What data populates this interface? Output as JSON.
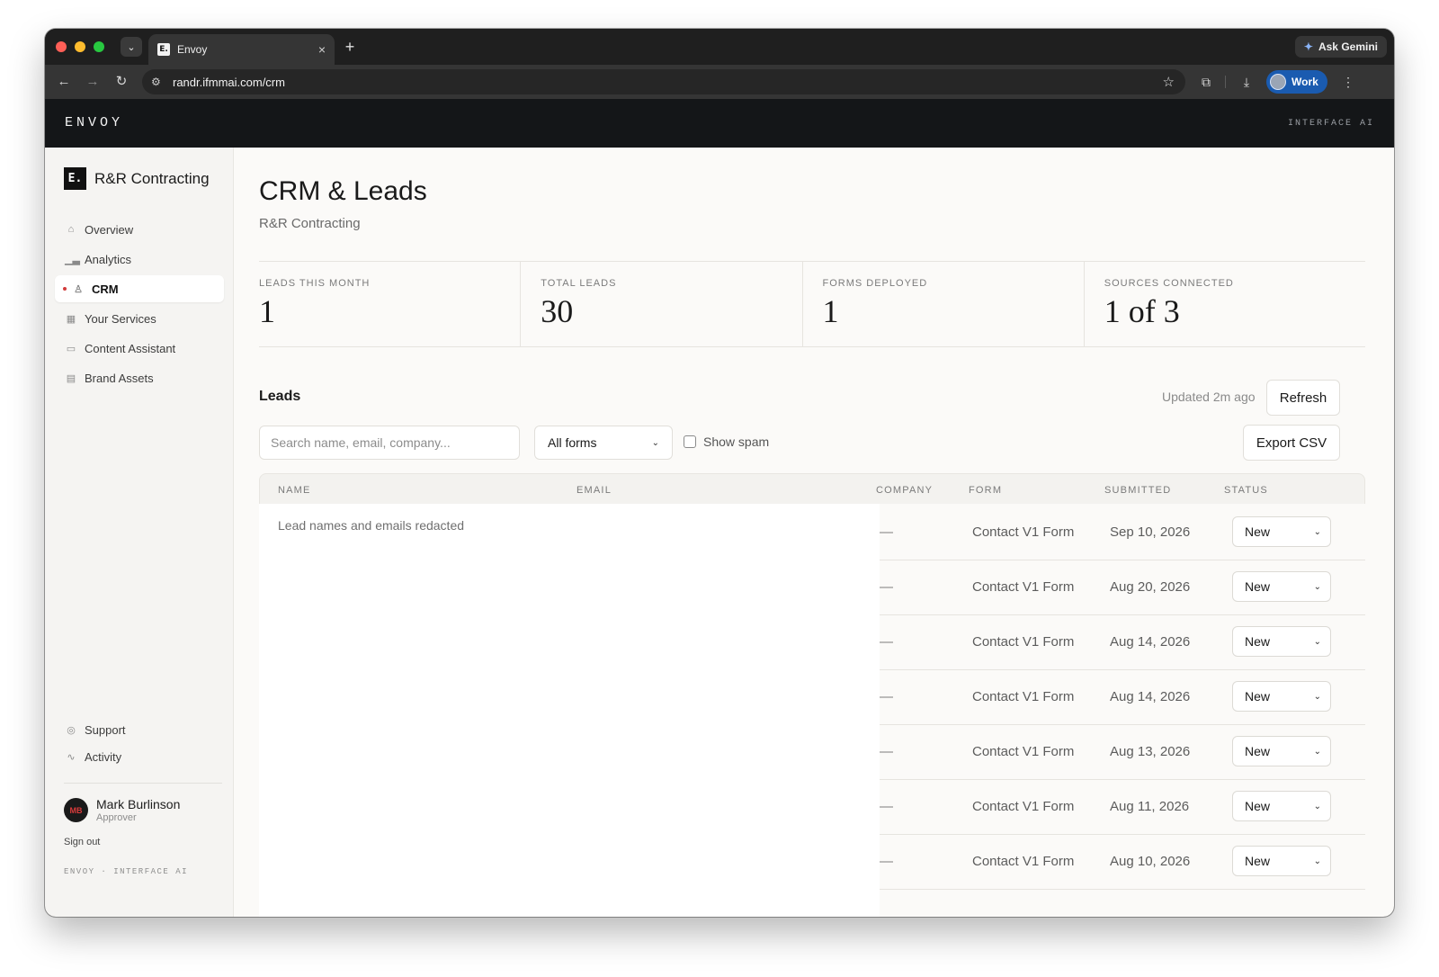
{
  "browser": {
    "tab_title": "Envoy",
    "tab_favicon": "E.",
    "url": "randr.ifmmai.com/crm",
    "gemini_label": "Ask Gemini",
    "profile_label": "Work"
  },
  "app_header": {
    "brand": "ENVOY",
    "right_label": "INTERFACE AI"
  },
  "sidebar": {
    "org_logo": "E.",
    "org_name": "R&R Contracting",
    "items": [
      {
        "label": "Overview",
        "icon": "home-icon"
      },
      {
        "label": "Analytics",
        "icon": "bar-chart-icon"
      },
      {
        "label": "CRM",
        "icon": "person-icon",
        "active": true
      },
      {
        "label": "Your Services",
        "icon": "grid-icon"
      },
      {
        "label": "Content Assistant",
        "icon": "chat-icon"
      },
      {
        "label": "Brand Assets",
        "icon": "layers-icon"
      }
    ],
    "bottom_items": [
      {
        "label": "Support",
        "icon": "lifebuoy-icon"
      },
      {
        "label": "Activity",
        "icon": "pulse-icon"
      }
    ],
    "user": {
      "initials": "MB",
      "name": "Mark Burlinson",
      "role": "Approver"
    },
    "signout": "Sign out",
    "footer": "ENVOY · INTERFACE AI"
  },
  "main": {
    "title": "CRM & Leads",
    "subtitle": "R&R Contracting",
    "stats": [
      {
        "label": "LEADS THIS MONTH",
        "value": "1"
      },
      {
        "label": "TOTAL LEADS",
        "value": "30"
      },
      {
        "label": "FORMS DEPLOYED",
        "value": "1"
      },
      {
        "label": "SOURCES CONNECTED",
        "value": "1 of 3"
      }
    ],
    "leads": {
      "title": "Leads",
      "updated": "Updated 2m ago",
      "refresh_label": "Refresh",
      "export_label": "Export CSV",
      "search_placeholder": "Search name, email, company...",
      "forms_filter": "All forms",
      "spam_label": "Show spam",
      "columns": [
        "NAME",
        "EMAIL",
        "COMPANY",
        "FORM",
        "SUBMITTED",
        "STATUS"
      ],
      "redacted_note": "Lead names and emails redacted",
      "rows": [
        {
          "company": "—",
          "form": "Contact V1 Form",
          "submitted": "Sep 10, 2026",
          "status": "New"
        },
        {
          "company": "—",
          "form": "Contact V1 Form",
          "submitted": "Aug 20, 2026",
          "status": "New"
        },
        {
          "company": "—",
          "form": "Contact V1 Form",
          "submitted": "Aug 14, 2026",
          "status": "New"
        },
        {
          "company": "—",
          "form": "Contact V1 Form",
          "submitted": "Aug 14, 2026",
          "status": "New"
        },
        {
          "company": "—",
          "form": "Contact V1 Form",
          "submitted": "Aug 13, 2026",
          "status": "New"
        },
        {
          "company": "—",
          "form": "Contact V1 Form",
          "submitted": "Aug 11, 2026",
          "status": "New"
        },
        {
          "company": "—",
          "form": "Contact V1 Form",
          "submitted": "Aug 10, 2026",
          "status": "New"
        }
      ]
    }
  }
}
